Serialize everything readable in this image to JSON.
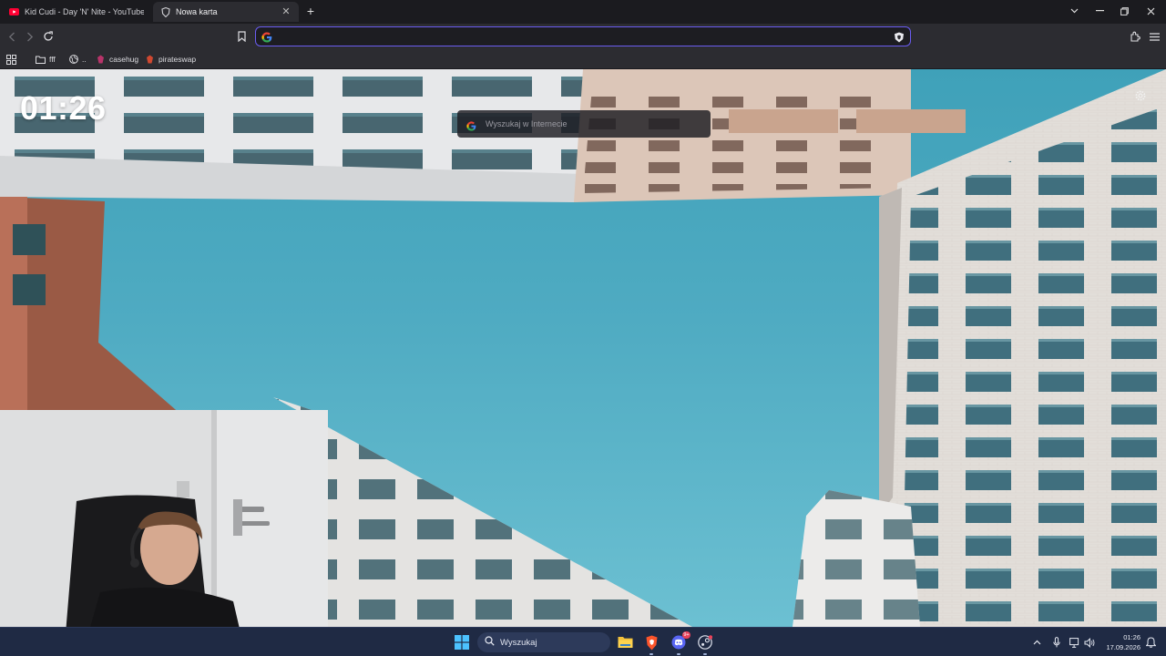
{
  "browser": {
    "tabs": [
      {
        "label": "Kid Cudi - Day 'N' Nite - YouTube",
        "icon": "youtube-icon",
        "active": false
      },
      {
        "label": "Nowa karta",
        "icon": "brave-shield-icon",
        "active": true
      }
    ],
    "address_bar": {
      "value": "",
      "placeholder": ""
    },
    "bookmarks": [
      {
        "label": "fff",
        "icon": "folder-icon"
      },
      {
        "label": "..",
        "icon": "globe-icon"
      },
      {
        "label": "casehug",
        "icon": "casehug-icon"
      },
      {
        "label": "pirateswap",
        "icon": "pirateswap-icon"
      }
    ]
  },
  "new_tab_page": {
    "clock": "01:26",
    "search_placeholder": "Wyszukaj w Internecie"
  },
  "taskbar": {
    "search_placeholder": "Wyszukaj",
    "discord_badge": "9+",
    "time": "01:26",
    "date": "17.09.2026"
  },
  "colors": {
    "accent": "#6a5cf0",
    "sky": "#4fabc2",
    "taskbar": "#1f2a44"
  }
}
